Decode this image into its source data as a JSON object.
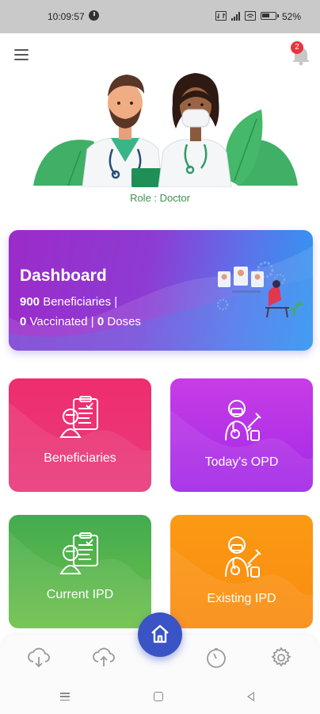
{
  "status_bar": {
    "time": "10:09:57",
    "battery_text": "52%",
    "icons": [
      "alarm-icon",
      "data-icon",
      "signal-icon",
      "wifi-icon",
      "battery-icon"
    ]
  },
  "header": {
    "menu_icon": "hamburger-menu-icon",
    "notification_icon": "bell-icon",
    "notification_count": "2"
  },
  "hero": {
    "role_text": "Role : Doctor"
  },
  "dashboard": {
    "title": "Dashboard",
    "beneficiaries_count": "900",
    "beneficiaries_label": "Beneficiaries",
    "separator": "|",
    "vaccinated_count": "0",
    "vaccinated_label": "Vaccinated",
    "doses_count": "0",
    "doses_label": "Doses",
    "gradient_colors": [
      "#9b2bc9",
      "#2e9af2"
    ]
  },
  "tiles": [
    {
      "label": "Beneficiaries",
      "icon": "clipboard-doctor-icon",
      "color": "#ee2d6e"
    },
    {
      "label": "Today's OPD",
      "icon": "doctor-vaccine-icon",
      "color": "#b533e7"
    },
    {
      "label": "Current IPD",
      "icon": "clipboard-doctor-icon",
      "color": "#54b44c"
    },
    {
      "label": "Existing IPD",
      "icon": "doctor-vaccine-icon",
      "color": "#fa940f"
    }
  ],
  "bottom_nav": {
    "items": [
      "cloud-download-icon",
      "cloud-upload-icon",
      "home-icon",
      "timer-icon",
      "settings-icon"
    ],
    "active": "home-icon",
    "accent": "#3a53c5"
  },
  "android_nav": {
    "items": [
      "recent-apps-icon",
      "home-square-icon",
      "back-triangle-icon"
    ]
  }
}
